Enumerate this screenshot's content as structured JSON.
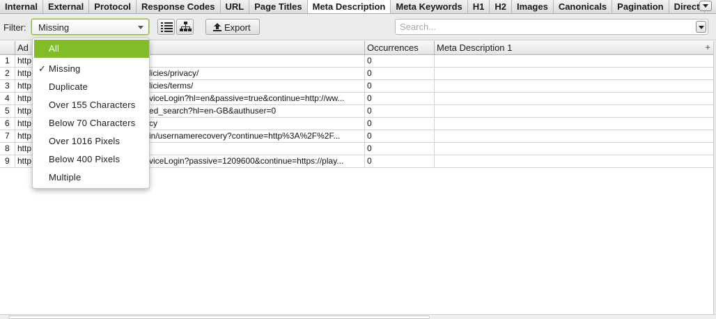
{
  "tabs": [
    {
      "label": "Internal",
      "active": false
    },
    {
      "label": "External",
      "active": false
    },
    {
      "label": "Protocol",
      "active": false
    },
    {
      "label": "Response Codes",
      "active": false
    },
    {
      "label": "URL",
      "active": false
    },
    {
      "label": "Page Titles",
      "active": false
    },
    {
      "label": "Meta Description",
      "active": true
    },
    {
      "label": "Meta Keywords",
      "active": false
    },
    {
      "label": "H1",
      "active": false
    },
    {
      "label": "H2",
      "active": false
    },
    {
      "label": "Images",
      "active": false
    },
    {
      "label": "Canonicals",
      "active": false
    },
    {
      "label": "Pagination",
      "active": false
    },
    {
      "label": "Direct",
      "active": false
    }
  ],
  "toolbar": {
    "filter_label": "Filter:",
    "filter_value": "Missing",
    "export_label": "Export",
    "search_placeholder": "Search...",
    "view_list_icon": "list-view-icon",
    "view_tree_icon": "tree-view-icon",
    "export_icon": "upload-icon"
  },
  "table": {
    "columns": {
      "row_number": "",
      "address": "Ad",
      "occurrences": "Occurrences",
      "meta_description": "Meta Description 1",
      "add_column": "+"
    },
    "rows": [
      {
        "num": "1",
        "address": "http",
        "tail": "",
        "occurrences": "0",
        "meta": ""
      },
      {
        "num": "2",
        "address": "http",
        "tail": "licies/privacy/",
        "occurrences": "0",
        "meta": ""
      },
      {
        "num": "3",
        "address": "http",
        "tail": "licies/terms/",
        "occurrences": "0",
        "meta": ""
      },
      {
        "num": "4",
        "address": "http",
        "tail": "viceLogin?hl=en&passive=true&continue=http://ww...",
        "occurrences": "0",
        "meta": ""
      },
      {
        "num": "5",
        "address": "http",
        "tail": "ed_search?hl=en-GB&authuser=0",
        "occurrences": "0",
        "meta": ""
      },
      {
        "num": "6",
        "address": "http",
        "tail": "cy",
        "occurrences": "0",
        "meta": ""
      },
      {
        "num": "7",
        "address": "http",
        "tail": "in/usernamerecovery?continue=http%3A%2F%2F...",
        "occurrences": "0",
        "meta": ""
      },
      {
        "num": "8",
        "address": "http",
        "tail": "",
        "occurrences": "0",
        "meta": ""
      },
      {
        "num": "9",
        "address": "http",
        "tail": "viceLogin?passive=1209600&continue=https://play...",
        "occurrences": "0",
        "meta": ""
      }
    ]
  },
  "filter_menu": {
    "items": [
      {
        "label": "All",
        "highlighted": true,
        "checked": false
      },
      {
        "label": "Missing",
        "highlighted": false,
        "checked": true
      },
      {
        "label": "Duplicate",
        "highlighted": false,
        "checked": false
      },
      {
        "label": "Over 155 Characters",
        "highlighted": false,
        "checked": false
      },
      {
        "label": "Below 70 Characters",
        "highlighted": false,
        "checked": false
      },
      {
        "label": "Over 1016 Pixels",
        "highlighted": false,
        "checked": false
      },
      {
        "label": "Below 400 Pixels",
        "highlighted": false,
        "checked": false
      },
      {
        "label": "Multiple",
        "highlighted": false,
        "checked": false
      }
    ],
    "check_mark": "✓"
  },
  "colors": {
    "accent_green": "#82bc28",
    "focus_ring": "#8ebd3d"
  }
}
